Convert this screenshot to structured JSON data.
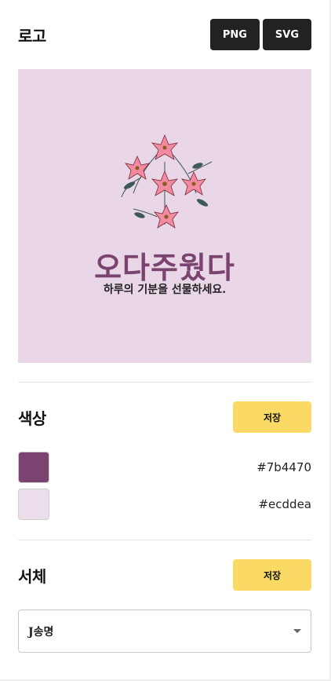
{
  "logo_section": {
    "title": "로고",
    "png_label": "PNG",
    "svg_label": "SVG",
    "preview": {
      "title": "오다주웠다",
      "tagline": "하루의 기분을 선물하세요.",
      "background": "#ecddea",
      "title_color": "#7b4470",
      "icon": "lily-flower-bouquet-icon"
    }
  },
  "color_section": {
    "title": "색상",
    "save_label": "저장",
    "swatches": [
      {
        "hex": "#7b4470"
      },
      {
        "hex": "#ecddea"
      }
    ]
  },
  "font_section": {
    "title": "서체",
    "save_label": "저장",
    "selected_font": "J송명"
  },
  "colors": {
    "button_dark": "#222222",
    "button_yellow": "#fbd965"
  }
}
